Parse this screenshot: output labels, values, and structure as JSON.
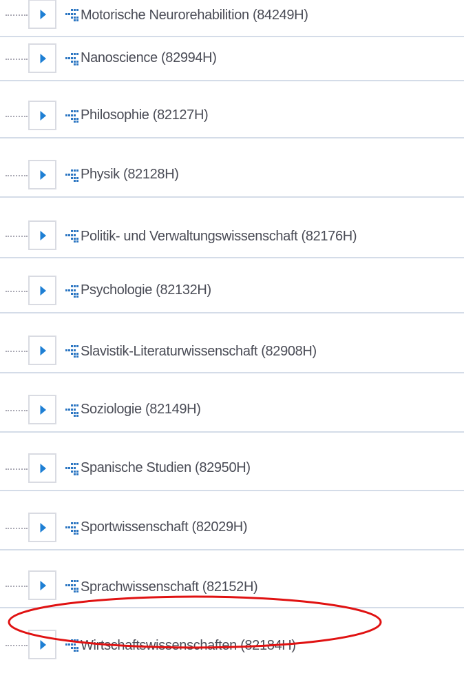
{
  "tree": {
    "items": [
      {
        "label": "Motorische Neurorehabilition (84249H)"
      },
      {
        "label": "Nanoscience (82994H)"
      },
      {
        "label": "Philosophie (82127H)"
      },
      {
        "label": "Physik (82128H)"
      },
      {
        "label": "Politik- und Verwaltungswissenschaft (82176H)"
      },
      {
        "label": "Psychologie (82132H)"
      },
      {
        "label": "Slavistik-Literaturwissenschaft (82908H)"
      },
      {
        "label": "Soziologie (82149H)"
      },
      {
        "label": "Spanische Studien (82950H)"
      },
      {
        "label": "Sportwissenschaft (82029H)"
      },
      {
        "label": "Sprachwissenschaft (82152H)",
        "highlighted": true
      },
      {
        "label": "Wirtschaftswissenschaften (82184H)"
      }
    ]
  },
  "icons": {
    "expander": "chevron-right-icon",
    "node": "org-unit-icon"
  },
  "colors": {
    "chevron": "#1e7fd4",
    "node_icon": "#2c76c2",
    "label": "#4a4c56",
    "divider": "#d4dce8",
    "highlight": "#e01212"
  }
}
